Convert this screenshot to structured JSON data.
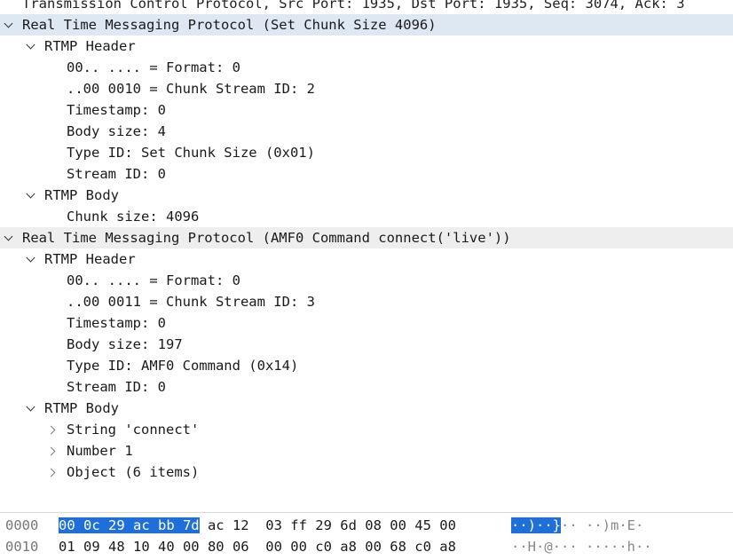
{
  "tree": [
    {
      "text": "Transmission Control Protocol, Src Port: 1935, Dst Port: 1935, Seq: 3074, Ack: 3",
      "arrow": "none",
      "indent": 0,
      "style": "partial"
    },
    {
      "text": "Real Time Messaging Protocol (Set Chunk Size 4096)",
      "arrow": "down",
      "indent": 0,
      "style": "sel"
    },
    {
      "text": "RTMP Header",
      "arrow": "down",
      "indent": 1,
      "style": ""
    },
    {
      "text": "00.. .... = Format: 0",
      "arrow": "none",
      "indent": 2,
      "style": ""
    },
    {
      "text": "..00 0010 = Chunk Stream ID: 2",
      "arrow": "none",
      "indent": 2,
      "style": ""
    },
    {
      "text": "Timestamp: 0",
      "arrow": "none",
      "indent": 2,
      "style": ""
    },
    {
      "text": "Body size: 4",
      "arrow": "none",
      "indent": 2,
      "style": ""
    },
    {
      "text": "Type ID: Set Chunk Size (0x01)",
      "arrow": "none",
      "indent": 2,
      "style": ""
    },
    {
      "text": "Stream ID: 0",
      "arrow": "none",
      "indent": 2,
      "style": ""
    },
    {
      "text": "RTMP Body",
      "arrow": "down",
      "indent": 1,
      "style": ""
    },
    {
      "text": "Chunk size: 4096",
      "arrow": "none",
      "indent": 2,
      "style": ""
    },
    {
      "text": "Real Time Messaging Protocol (AMF0 Command connect('live'))",
      "arrow": "down",
      "indent": 0,
      "style": "alt"
    },
    {
      "text": "RTMP Header",
      "arrow": "down",
      "indent": 1,
      "style": ""
    },
    {
      "text": "00.. .... = Format: 0",
      "arrow": "none",
      "indent": 2,
      "style": ""
    },
    {
      "text": "..00 0011 = Chunk Stream ID: 3",
      "arrow": "none",
      "indent": 2,
      "style": ""
    },
    {
      "text": "Timestamp: 0",
      "arrow": "none",
      "indent": 2,
      "style": ""
    },
    {
      "text": "Body size: 197",
      "arrow": "none",
      "indent": 2,
      "style": ""
    },
    {
      "text": "Type ID: AMF0 Command (0x14)",
      "arrow": "none",
      "indent": 2,
      "style": ""
    },
    {
      "text": "Stream ID: 0",
      "arrow": "none",
      "indent": 2,
      "style": ""
    },
    {
      "text": "RTMP Body",
      "arrow": "down",
      "indent": 1,
      "style": ""
    },
    {
      "text": "String 'connect'",
      "arrow": "right",
      "indent": 2,
      "style": ""
    },
    {
      "text": "Number 1",
      "arrow": "right",
      "indent": 2,
      "style": ""
    },
    {
      "text": "Object (6 items)",
      "arrow": "right",
      "indent": 2,
      "style": ""
    }
  ],
  "hex": {
    "rows": [
      {
        "offset": "0000",
        "bytes_hl": "00 0c 29 ac bb 7d",
        "bytes_rest": " ac 12  03 ff 29 6d 08 00 45 00",
        "ascii_hl": "··)··}",
        "ascii_rest": "·· ··)m·E·"
      },
      {
        "offset": "0010",
        "bytes_hl": "",
        "bytes_rest": "01 09 48 10 40 00 80 06  00 00 c0 a8 00 68 c0 a8",
        "ascii_hl": "",
        "ascii_rest": "··H·@··· ·····h··"
      }
    ]
  },
  "colors": {
    "selected_row": "#dde8f3",
    "highlight": "#1e6fd9"
  }
}
